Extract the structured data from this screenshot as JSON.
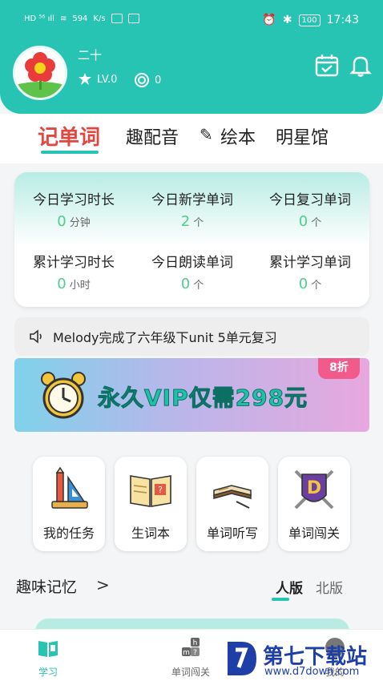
{
  "statusbar": {
    "left_text": "HD ⁵⁶ᴵ ᵢₗₗ 594 K/s",
    "speed_value": "594",
    "speed_unit": "K/s",
    "battery": "100",
    "time": "17:43"
  },
  "profile": {
    "username": "二十",
    "level": "LV.0",
    "coins": "0",
    "icons": {
      "calendar": "calendar-check-icon",
      "bell": "bell-icon"
    }
  },
  "tabs": [
    {
      "label": "记单词",
      "active": true
    },
    {
      "label": "趣配音",
      "active": false
    },
    {
      "label": "绘本",
      "active": false
    },
    {
      "label": "明星馆",
      "active": false
    }
  ],
  "stats": [
    {
      "label": "今日学习时长",
      "value": "0",
      "unit": "分钟"
    },
    {
      "label": "今日新学单词",
      "value": "2",
      "unit": "个"
    },
    {
      "label": "今日复习单词",
      "value": "0",
      "unit": "个"
    },
    {
      "label": "累计学习时长",
      "value": "0",
      "unit": "小时"
    },
    {
      "label": "今日朗读单词",
      "value": "0",
      "unit": "个"
    },
    {
      "label": "累计学习单词",
      "value": "0",
      "unit": "个"
    }
  ],
  "notice": {
    "text": "Melody完成了六年级下unit 5单元复习"
  },
  "banner": {
    "text": "永久VIP仅需298元",
    "badge": "8折"
  },
  "features": [
    {
      "label": "我的任务",
      "icon": "ruler-pencil-icon"
    },
    {
      "label": "生词本",
      "icon": "book-icon"
    },
    {
      "label": "单词听写",
      "icon": "writing-book-icon"
    },
    {
      "label": "单词闯关",
      "icon": "d-shield-icon"
    }
  ],
  "section": {
    "title": "趣味记忆",
    "arrow": ">",
    "versions": [
      {
        "label": "人版",
        "active": true
      },
      {
        "label": "北版",
        "active": false
      }
    ]
  },
  "bottom_nav": [
    {
      "label": "学习",
      "icon": "book-open-icon",
      "active": true
    },
    {
      "label": "单词闯关",
      "icon": "letters-blocks-icon",
      "active": false
    },
    {
      "label": "我的",
      "icon": "user-icon",
      "active": false
    }
  ],
  "watermark": {
    "title": "第七下载站",
    "url": "www.d7down.com"
  },
  "colors": {
    "brand": "#27c4b3",
    "active_tab": "#e2473f",
    "stat_value": "#4dcf8e"
  }
}
